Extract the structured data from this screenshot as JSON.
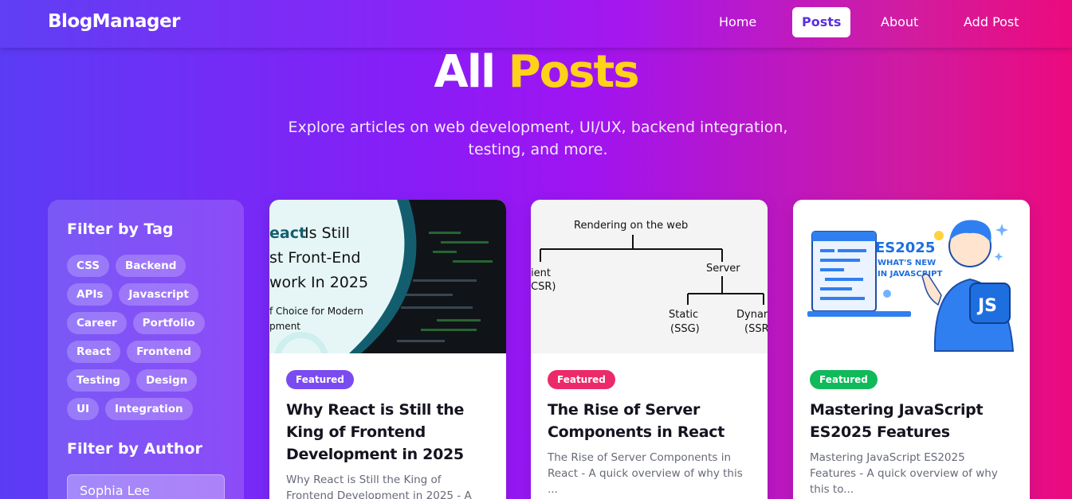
{
  "brand": "BlogManager",
  "nav": [
    {
      "label": "Home"
    },
    {
      "label": "Posts"
    },
    {
      "label": "About"
    },
    {
      "label": "Add Post"
    }
  ],
  "hero": {
    "title_part1": "All",
    "title_part2": "Posts",
    "subtitle": "Explore articles on web development, UI/UX, backend integration, testing, and more."
  },
  "sidebar": {
    "tag_heading": "Filter by Tag",
    "tags": [
      "CSS",
      "Backend",
      "APIs",
      "Javascript",
      "Career",
      "Portfolio",
      "React",
      "Frontend",
      "Testing",
      "Design",
      "UI",
      "Integration"
    ],
    "author_heading": "Filter by Author",
    "author_value": "Sophia Lee"
  },
  "posts": [
    {
      "badge": "Featured",
      "badge_color": "#7a4bf0",
      "title": "Why React is Still the King of Frontend Development in 2025",
      "excerpt": "Why React is Still the King of Frontend Development in 2025 - A",
      "image_text": {
        "line1_a": "eact",
        "line1_b": " Is Still",
        "line2": "st Front-End",
        "line3": "work In 2025",
        "line4": "f Choice for Modern",
        "line5": "pment"
      }
    },
    {
      "badge": "Featured",
      "badge_color": "#ec2a6a",
      "title": "The Rise of Server Components in React",
      "excerpt": "The Rise of Server Components in React - A quick overview of why this ...",
      "image_text": {
        "root": "Rendering on the web",
        "client_a": "ient",
        "client_b": "CSR)",
        "server": "Server",
        "static_a": "Static",
        "static_b": "(SSG)",
        "dynamic_a": "Dynar",
        "dynamic_b": "(SSR"
      }
    },
    {
      "badge": "Featured",
      "badge_color": "#10b95a",
      "title": "Mastering JavaScript ES2025 Features",
      "excerpt": "Mastering JavaScript ES2025 Features - A quick overview of why this to...",
      "image_text": {
        "line1": "ES2025",
        "line2": "WHAT'S NEW",
        "line3": "IN JAVASCRIPT",
        "js": "JS"
      }
    }
  ]
}
